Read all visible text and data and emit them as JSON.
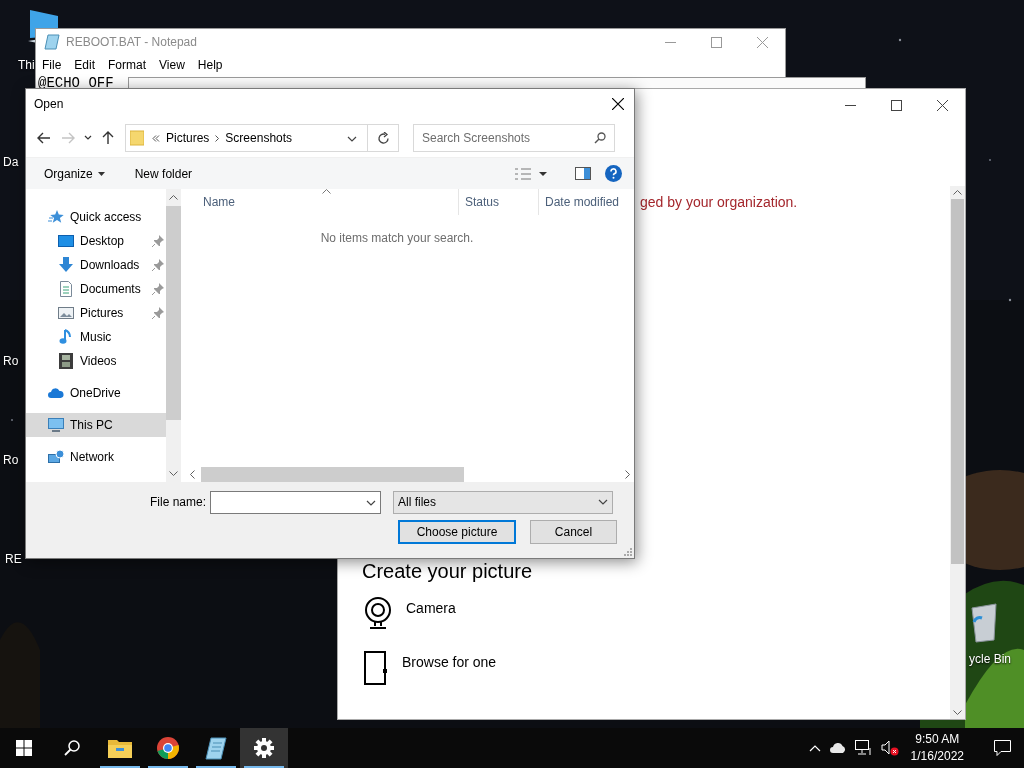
{
  "desktop": {
    "kind": "picture",
    "icons": [
      {
        "label": "Thi",
        "kind": "pc"
      },
      {
        "label": "Da"
      },
      {
        "label": "Ro"
      },
      {
        "label": "Ro"
      },
      {
        "label": "RE"
      },
      {
        "label": "ycle Bin",
        "kind": "bin"
      }
    ]
  },
  "notepad": {
    "title": "REBOOT.BAT - Notepad",
    "menu": [
      "File",
      "Edit",
      "Format",
      "View",
      "Help"
    ],
    "text": "@ECHO OFF"
  },
  "settings_window": {
    "message": "ged by your organization.",
    "section_title": "Create your picture",
    "options": [
      {
        "label": "Camera",
        "kind": "camera"
      },
      {
        "label": "Browse for one",
        "kind": "browse"
      }
    ]
  },
  "dialog": {
    "title": "Open",
    "nav_buttons": [
      {
        "kind": "back",
        "disabled": false
      },
      {
        "kind": "forward",
        "disabled": true
      },
      {
        "kind": "recent",
        "disabled": false
      },
      {
        "kind": "up",
        "disabled": false
      }
    ],
    "breadcrumb": [
      "Pictures",
      "Screenshots"
    ],
    "search": {
      "placeholder": "Search Screenshots"
    },
    "toolbar": [
      {
        "label": "Organize",
        "kind": "menu"
      },
      {
        "label": "New folder",
        "kind": "button"
      }
    ],
    "nav": [
      {
        "label": "Quick access",
        "kind": "star",
        "selected": false,
        "children": [
          {
            "label": "Desktop",
            "kind": "desktop",
            "pinned": true,
            "selected": false
          },
          {
            "label": "Downloads",
            "kind": "download",
            "pinned": true,
            "selected": false
          },
          {
            "label": "Documents",
            "kind": "document",
            "pinned": true,
            "selected": false
          },
          {
            "label": "Pictures",
            "kind": "picture",
            "pinned": true,
            "selected": false
          },
          {
            "label": "Music",
            "kind": "music",
            "pinned": false,
            "selected": false
          },
          {
            "label": "Videos",
            "kind": "video",
            "pinned": false,
            "selected": false
          }
        ]
      },
      {
        "label": "OneDrive",
        "kind": "cloud",
        "selected": false
      },
      {
        "label": "This PC",
        "kind": "pc",
        "selected": true
      },
      {
        "label": "Network",
        "kind": "network",
        "selected": false
      }
    ],
    "columns": [
      "Name",
      "Status",
      "Date modified"
    ],
    "empty_message": "No items match your search.",
    "file_name_label": "File name:",
    "file_type": "All files",
    "buttons": [
      {
        "label": "Choose picture",
        "default": true
      },
      {
        "label": "Cancel",
        "default": false
      }
    ]
  },
  "taskbar": {
    "apps": [
      {
        "kind": "explorer",
        "open": true,
        "active": false
      },
      {
        "kind": "browser",
        "open": true,
        "active": false
      },
      {
        "kind": "notepad",
        "open": true,
        "active": false
      },
      {
        "kind": "settings",
        "open": true,
        "active": true
      }
    ],
    "clock": {
      "time": "9:50 AM",
      "date": "1/16/2022"
    }
  }
}
